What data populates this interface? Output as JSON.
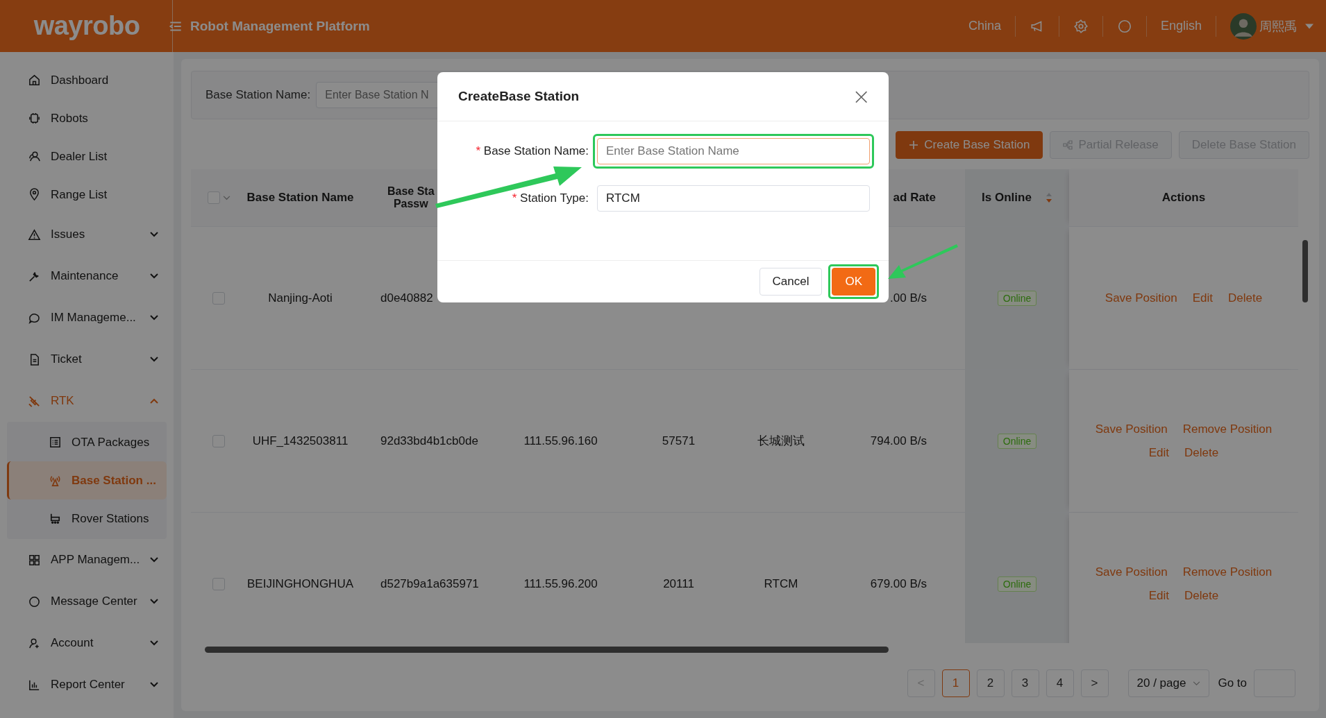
{
  "header": {
    "logo": "wayrobo",
    "title": "Robot Management Platform",
    "region": "China",
    "language": "English",
    "user": "周熙禹"
  },
  "sidebar": {
    "items": [
      {
        "label": "Dashboard",
        "kind": "link",
        "selected": false
      },
      {
        "label": "Robots",
        "kind": "link",
        "selected": false
      },
      {
        "label": "Dealer List",
        "kind": "link",
        "selected": false
      },
      {
        "label": "Range List",
        "kind": "link",
        "selected": false
      },
      {
        "label": "Issues",
        "kind": "group",
        "selected": false,
        "expanded": false
      },
      {
        "label": "Maintenance",
        "kind": "group",
        "selected": false,
        "expanded": false
      },
      {
        "label": "IM Manageme...",
        "kind": "group",
        "selected": false,
        "expanded": false
      },
      {
        "label": "Ticket",
        "kind": "group",
        "selected": false,
        "expanded": false
      },
      {
        "label": "RTK",
        "kind": "group",
        "selected": true,
        "expanded": true,
        "children": [
          {
            "label": "OTA Packages",
            "selected": false
          },
          {
            "label": "Base Station ...",
            "selected": true
          },
          {
            "label": "Rover Stations",
            "selected": false
          }
        ]
      },
      {
        "label": "APP Managem...",
        "kind": "group",
        "selected": false,
        "expanded": false
      },
      {
        "label": "Message Center",
        "kind": "group",
        "selected": false,
        "expanded": false
      },
      {
        "label": "Account",
        "kind": "group",
        "selected": false,
        "expanded": false
      },
      {
        "label": "Report Center",
        "kind": "group",
        "selected": false,
        "expanded": false
      }
    ]
  },
  "filter": {
    "label": "Base Station Name:",
    "placeholder": "Enter Base Station N"
  },
  "toolbar": [
    {
      "label": "Create Base Station",
      "kind": "create",
      "disabled": false
    },
    {
      "label": "Partial Release",
      "kind": "release",
      "disabled": true
    },
    {
      "label": "Delete Base Station",
      "kind": "plain",
      "disabled": true
    }
  ],
  "table": {
    "select_all": {
      "checked": false
    },
    "columns": [
      {
        "lines": [
          "Base Station Name"
        ],
        "sortable": false
      },
      {
        "lines": [
          "Base Sta",
          "Passw"
        ]
      },
      {},
      {},
      {},
      {
        "lines": [
          "ad Rate"
        ],
        "sortable": false
      },
      {
        "lines": [
          "Is Online"
        ],
        "sortable": true
      },
      {
        "lines": [
          "Actions"
        ],
        "sortable": false
      }
    ],
    "rows": [
      {
        "checked": false,
        "cells": [
          "Nanjing-Aoti",
          "d0e40882",
          null,
          null,
          null,
          ".00 B/s"
        ],
        "status": "Online",
        "online": true,
        "actions": [
          "Save Position",
          "Edit",
          "Delete"
        ]
      },
      {
        "checked": false,
        "cells": [
          "UHF_1432503811",
          "92d33bd4b1cb0de",
          "111.55.96.160",
          "57571",
          "长城测试",
          "794.00 B/s"
        ],
        "status": "Online",
        "online": true,
        "actions": [
          "Save Position",
          "Remove Position",
          "Edit",
          "Delete"
        ]
      },
      {
        "checked": false,
        "cells": [
          "BEIJINGHONGHUA",
          "d527b9a1a635971",
          "111.55.96.200",
          "20111",
          "RTCM",
          "679.00 B/s"
        ],
        "status": "Online",
        "online": true,
        "actions": [
          "Save Position",
          "Remove Position",
          "Edit",
          "Delete"
        ]
      }
    ]
  },
  "pagination": {
    "prev": "<",
    "next": ">",
    "pages": [
      {
        "label": "1",
        "selected": true
      },
      {
        "label": "2",
        "selected": false
      },
      {
        "label": "3",
        "selected": false
      },
      {
        "label": "4",
        "selected": false
      }
    ],
    "page_size": "20 / page",
    "goto_label": "Go to"
  },
  "dialog": {
    "title": "CreateBase Station",
    "close": "×",
    "fields": [
      {
        "mark": "*",
        "label": "Base Station Name:",
        "placeholder": "Enter Base Station Name",
        "focused": true,
        "highlighted": true
      },
      {
        "mark": "*",
        "label": "Station Type:",
        "value": "RTCM",
        "focused": false,
        "highlighted": false
      }
    ],
    "buttons": [
      {
        "label": "Cancel",
        "kind": "default",
        "highlighted": false
      },
      {
        "label": "OK",
        "kind": "primary",
        "highlighted": true
      }
    ]
  }
}
